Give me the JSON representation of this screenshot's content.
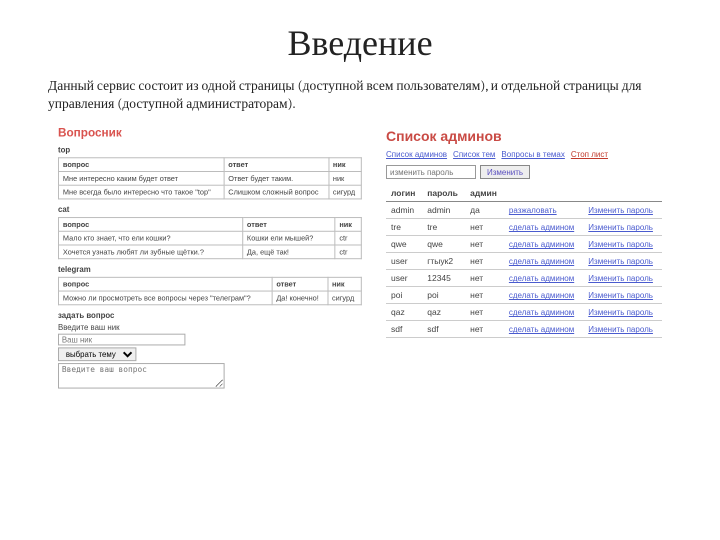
{
  "title": "Введение",
  "description": "Данный сервис состоит из одной страницы (доступной всем пользователям), и отдельной страницы для управления (доступной администраторам).",
  "left": {
    "heading": "Вопросник",
    "sections": [
      {
        "name": "top",
        "headers": [
          "вопрос",
          "ответ",
          "ник"
        ],
        "rows": [
          [
            "Мне интересно каким будет ответ",
            "Ответ будет таким.",
            "ник"
          ],
          [
            "Мне всегда было интересно что такое \"top\"",
            "Слишком сложный вопрос",
            "сигурд"
          ]
        ]
      },
      {
        "name": "cat",
        "headers": [
          "вопрос",
          "ответ",
          "ник"
        ],
        "rows": [
          [
            "Мало кто знает, что ели кошки?",
            "Кошки ели мышей?",
            "ctr"
          ],
          [
            "Хочется узнать любят ли зубные щётки.?",
            "Да, ещё так!",
            "ctr"
          ]
        ]
      },
      {
        "name": "telegram",
        "headers": [
          "вопрос",
          "ответ",
          "ник"
        ],
        "rows": [
          [
            "Можно ли просмотреть все вопросы через \"телеграм\"?",
            "Да! конечно!",
            "сигурд"
          ]
        ]
      }
    ],
    "form": {
      "title": "задать вопрос",
      "nick_label": "Введите ваш ник",
      "nick_placeholder": "Ваш ник",
      "select_placeholder": "выбрать тему",
      "textarea_placeholder": "Введите ваш вопрос"
    }
  },
  "right": {
    "heading": "Список админов",
    "links": [
      "Список админов",
      "Список тем",
      "Вопросы в темах",
      "Стоп лист"
    ],
    "pw_placeholder": "изменить пароль",
    "pw_button": "Изменить",
    "headers": [
      "логин",
      "пароль",
      "админ",
      "",
      ""
    ],
    "action_demote": "разжаловать",
    "action_promote": "сделать админом",
    "action_pw": "Изменить пароль",
    "rows": [
      {
        "login": "admin",
        "pass": "admin",
        "admin": "да",
        "act": "demote"
      },
      {
        "login": "tre",
        "pass": "tre",
        "admin": "нет",
        "act": "promote"
      },
      {
        "login": "qwe",
        "pass": "qwe",
        "admin": "нет",
        "act": "promote"
      },
      {
        "login": "user",
        "pass": "гтыук2",
        "admin": "нет",
        "act": "promote"
      },
      {
        "login": "user",
        "pass": "12345",
        "admin": "нет",
        "act": "promote"
      },
      {
        "login": "poi",
        "pass": "poi",
        "admin": "нет",
        "act": "promote"
      },
      {
        "login": "qaz",
        "pass": "qaz",
        "admin": "нет",
        "act": "promote"
      },
      {
        "login": "sdf",
        "pass": "sdf",
        "admin": "нет",
        "act": "promote"
      }
    ]
  }
}
